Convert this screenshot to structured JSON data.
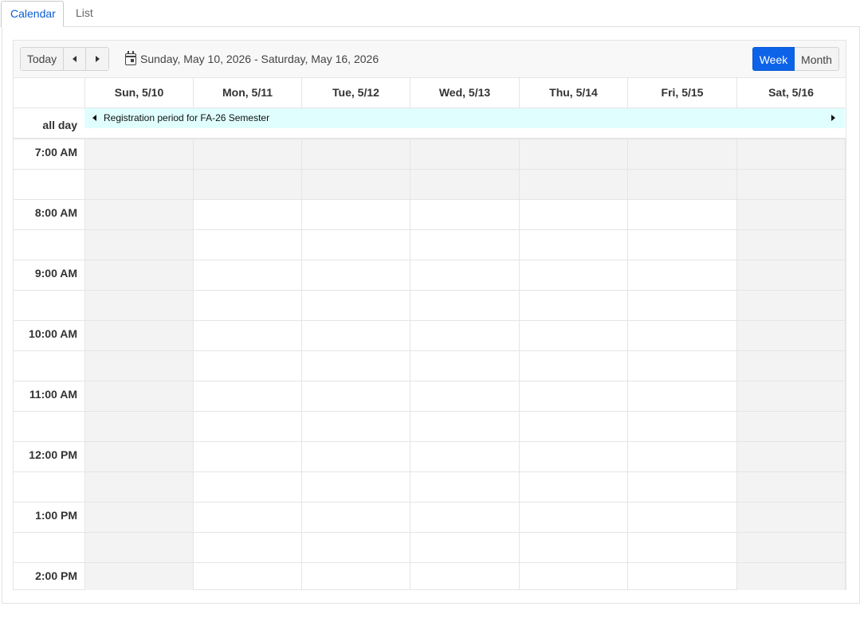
{
  "tabs": [
    {
      "label": "Calendar",
      "active": true
    },
    {
      "label": "List",
      "active": false
    }
  ],
  "toolbar": {
    "today_label": "Today",
    "prev_icon": "caret-left-icon",
    "next_icon": "caret-right-icon",
    "range_icon": "calendar-icon",
    "date_range": "Sunday, May 10, 2026 - Saturday, May 16, 2026",
    "views": [
      {
        "label": "Week",
        "active": true
      },
      {
        "label": "Month",
        "active": false
      }
    ]
  },
  "days": [
    "Sun, 5/10",
    "Mon, 5/11",
    "Tue, 5/12",
    "Wed, 5/13",
    "Thu, 5/14",
    "Fri, 5/15",
    "Sat, 5/16"
  ],
  "allday": {
    "label": "all day",
    "event": "Registration period for FA-26 Semester"
  },
  "times": [
    "7:00 AM",
    "8:00 AM",
    "9:00 AM",
    "10:00 AM",
    "11:00 AM",
    "12:00 PM",
    "1:00 PM",
    "2:00 PM"
  ],
  "colors": {
    "accent": "#0d63e8",
    "event_bg": "#e0fefe",
    "nonbusiness_bg": "#f3f3f3",
    "gridline": "#e5e5e5"
  }
}
